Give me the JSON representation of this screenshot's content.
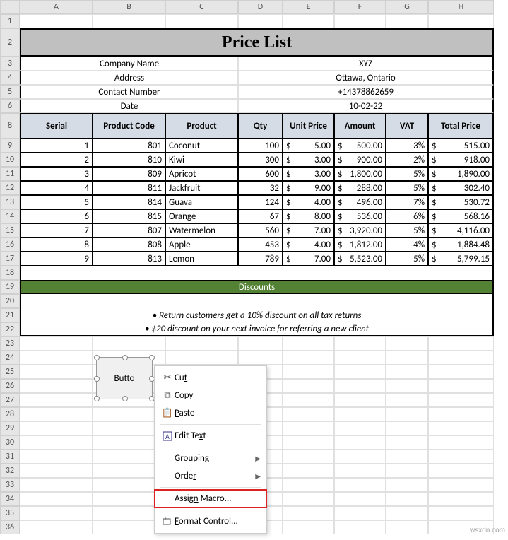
{
  "columns": [
    "A",
    "B",
    "C",
    "D",
    "E",
    "F",
    "G",
    "H"
  ],
  "title": "Price List",
  "info": {
    "company_label": "Company Name",
    "company_val": "XYZ",
    "address_label": "Address",
    "address_val": "Ottawa, Ontario",
    "contact_label": "Contact Number",
    "contact_val": "+14378862659",
    "date_label": "Date",
    "date_val": "10-02-22"
  },
  "headers": [
    "Serial",
    "Product Code",
    "Product",
    "Qty",
    "Unit Price",
    "Amount",
    "VAT",
    "Total Price"
  ],
  "rows": [
    {
      "serial": "1",
      "code": "801",
      "product": "Coconut",
      "qty": "100",
      "unit": "5.00",
      "amount": "500.00",
      "vat": "3%",
      "total": "515.00"
    },
    {
      "serial": "2",
      "code": "810",
      "product": "Kiwi",
      "qty": "300",
      "unit": "3.00",
      "amount": "900.00",
      "vat": "2%",
      "total": "918.00"
    },
    {
      "serial": "3",
      "code": "809",
      "product": "Apricot",
      "qty": "600",
      "unit": "3.00",
      "amount": "1,800.00",
      "vat": "5%",
      "total": "1,890.00"
    },
    {
      "serial": "4",
      "code": "811",
      "product": "Jackfruit",
      "qty": "32",
      "unit": "9.00",
      "amount": "288.00",
      "vat": "5%",
      "total": "302.40"
    },
    {
      "serial": "5",
      "code": "814",
      "product": "Guava",
      "qty": "124",
      "unit": "4.00",
      "amount": "496.00",
      "vat": "7%",
      "total": "530.72"
    },
    {
      "serial": "6",
      "code": "815",
      "product": "Orange",
      "qty": "67",
      "unit": "8.00",
      "amount": "536.00",
      "vat": "6%",
      "total": "568.16"
    },
    {
      "serial": "7",
      "code": "807",
      "product": "Watermelon",
      "qty": "560",
      "unit": "7.00",
      "amount": "3,920.00",
      "vat": "5%",
      "total": "4,116.00"
    },
    {
      "serial": "8",
      "code": "808",
      "product": "Apple",
      "qty": "453",
      "unit": "4.00",
      "amount": "1,812.00",
      "vat": "4%",
      "total": "1,884.48"
    },
    {
      "serial": "9",
      "code": "813",
      "product": "Lemon",
      "qty": "789",
      "unit": "7.00",
      "amount": "5,523.00",
      "vat": "5%",
      "total": "5,799.15"
    }
  ],
  "currency": "$",
  "discounts": {
    "header": "Discounts",
    "line1": "• Return customers get a 10% discount on all tax returns",
    "line2": "• $20 discount on your next invoice for referring a new client"
  },
  "button_label": "Butto",
  "ctx": {
    "cut": "Cut",
    "copy": "Copy",
    "paste": "Paste",
    "edit_text": "Edit Text",
    "grouping": "Grouping",
    "order": "Order",
    "assign_macro": "Assign Macro...",
    "format_control": "Format Control..."
  },
  "watermark": "wsxdn.com"
}
